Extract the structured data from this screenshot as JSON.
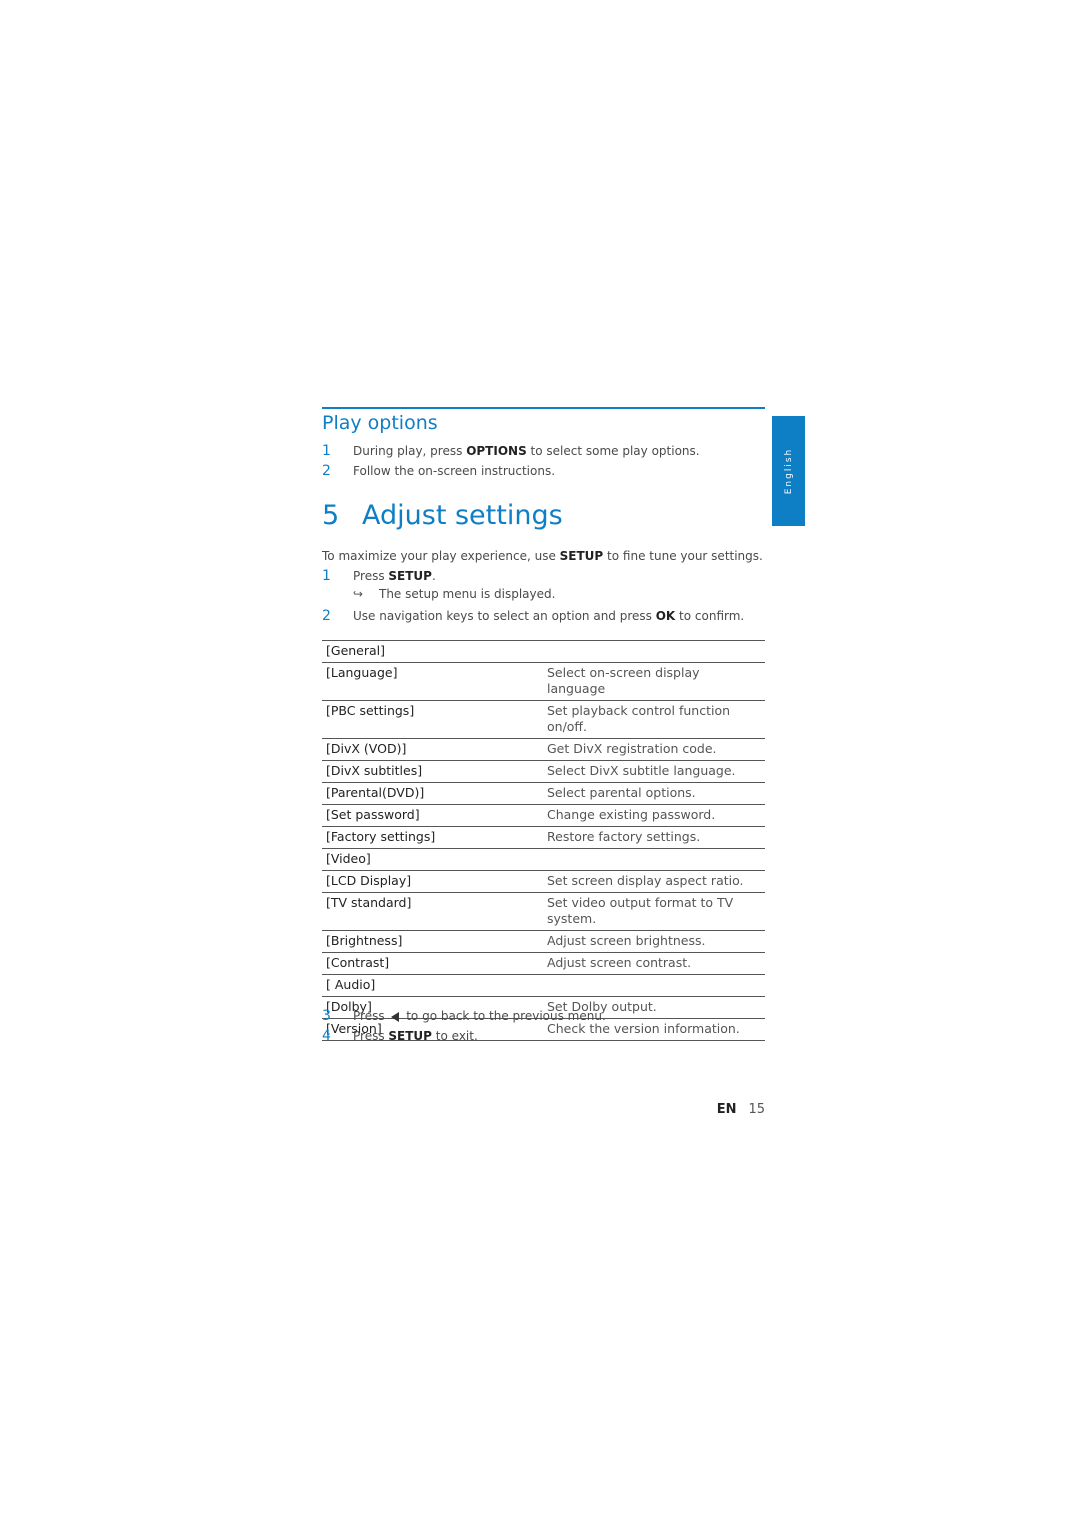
{
  "sidebar_tab": {
    "label": "English"
  },
  "play_options": {
    "heading": "Play options",
    "steps": [
      {
        "num": "1",
        "pre": "During play, press ",
        "key": "OPTIONS",
        "post": " to select some play options."
      },
      {
        "num": "2",
        "text": "Follow the on-screen instructions."
      }
    ]
  },
  "adjust_settings": {
    "chapter_num": "5",
    "heading": "Adjust settings",
    "intro": {
      "pre": "To maximize your play experience, use ",
      "key": "SETUP",
      "post": " to fine tune your settings."
    },
    "steps_before": [
      {
        "num": "1",
        "pre": "Press ",
        "key": "SETUP",
        "post": ".",
        "result": "The setup menu is displayed."
      },
      {
        "num": "2",
        "pre": "Use navigation keys to select an option and press ",
        "key": "OK",
        "post": " to confirm."
      }
    ],
    "table": [
      {
        "option": "[General]",
        "description": ""
      },
      {
        "option": "[Language]",
        "description": "Select on-screen display language"
      },
      {
        "option": "[PBC settings]",
        "description": "Set playback control function on/off."
      },
      {
        "option": "[DivX (VOD)]",
        "description": "Get DivX registration code."
      },
      {
        "option": "[DivX subtitles]",
        "description": "Select DivX subtitle language."
      },
      {
        "option": "[Parental(DVD)]",
        "description": "Select parental options."
      },
      {
        "option": "[Set password]",
        "description": "Change existing password."
      },
      {
        "option": "[Factory settings]",
        "description": "Restore factory settings."
      },
      {
        "option": "[Video]",
        "description": ""
      },
      {
        "option": "[LCD Display]",
        "description": "Set screen display aspect ratio."
      },
      {
        "option": "[TV standard]",
        "description": "Set video output format to TV system."
      },
      {
        "option": "[Brightness]",
        "description": "Adjust screen brightness."
      },
      {
        "option": "[Contrast]",
        "description": "Adjust screen contrast."
      },
      {
        "option": "[ Audio]",
        "description": ""
      },
      {
        "option": "[Dolby]",
        "description": "Set Dolby output."
      },
      {
        "option": "[Version]",
        "description": "Check the version information."
      }
    ],
    "steps_after": [
      {
        "num": "3",
        "pre": "Press ",
        "icon": "left-triangle-icon",
        "post": " to go back to the previous menu."
      },
      {
        "num": "4",
        "pre": "Press ",
        "key": "SETUP",
        "post": " to exit."
      }
    ]
  },
  "footer": {
    "lang": "EN",
    "page": "15"
  },
  "colors": {
    "accent": "#0f7fc5",
    "text": "#4a4a4a"
  }
}
